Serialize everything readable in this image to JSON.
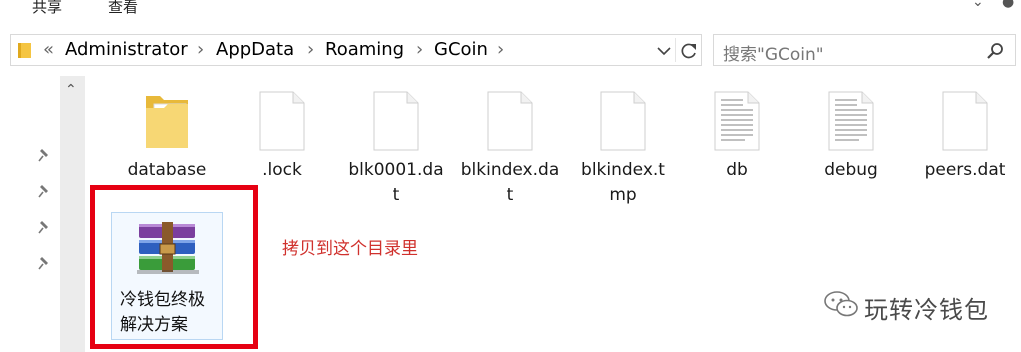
{
  "ribbon": {
    "tab_share": "共享",
    "tab_view": "查看"
  },
  "address": {
    "overflow": "«",
    "crumbs": [
      "Administrator",
      "AppData",
      "Roaming",
      "GCoin"
    ],
    "separator": "›"
  },
  "search": {
    "placeholder": "搜索\"GCoin\""
  },
  "files": [
    {
      "name": "database",
      "type": "folder"
    },
    {
      "name": ".lock",
      "type": "file"
    },
    {
      "name": "blk0001.dat",
      "type": "file"
    },
    {
      "name": "blkindex.dat",
      "type": "file"
    },
    {
      "name": "blkindex.tmp",
      "type": "file"
    },
    {
      "name": "db",
      "type": "text-file"
    },
    {
      "name": "debug",
      "type": "text-file"
    },
    {
      "name": "peers.dat",
      "type": "file"
    }
  ],
  "selected_item": {
    "name": "冷钱包终极解决方案",
    "line1": "冷钱包终极",
    "line2": "解决方案",
    "type": "rar-archive"
  },
  "annotation": "拷贝到这个目录里",
  "watermark": "玩转冷钱包",
  "colors": {
    "highlight": "#e60012",
    "annotation": "#d0312d",
    "folder": "#f7d774"
  }
}
